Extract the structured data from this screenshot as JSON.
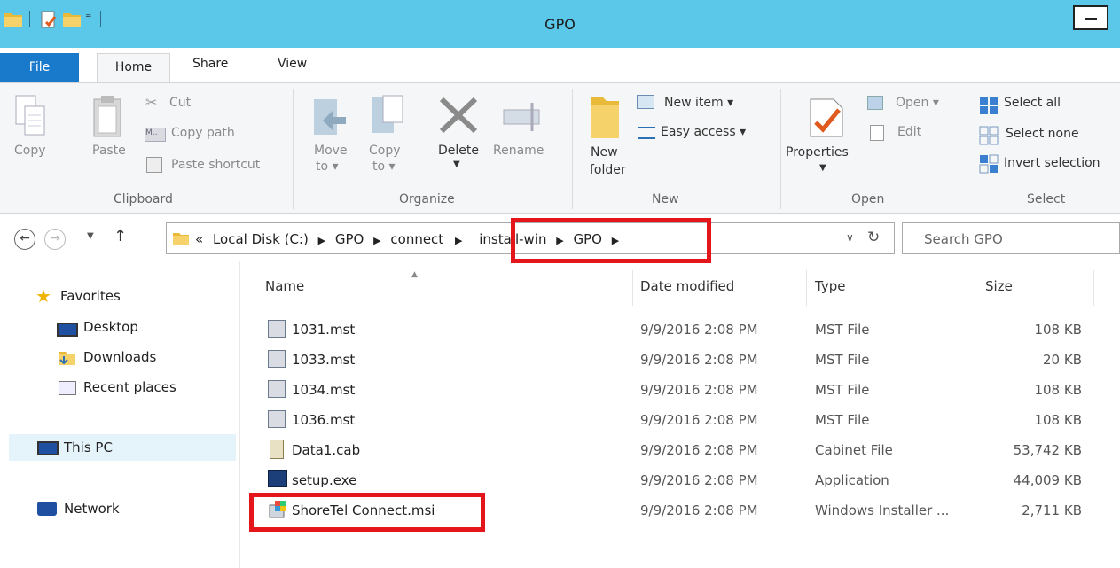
{
  "window": {
    "title": "GPO"
  },
  "tabs": {
    "file": "File",
    "home": "Home",
    "share": "Share",
    "view": "View"
  },
  "ribbon": {
    "copy": "Copy",
    "paste": "Paste",
    "cut": "Cut",
    "copy_path": "Copy path",
    "paste_shortcut": "Paste shortcut",
    "clipboard": "Clipboard",
    "move_to_1": "Move",
    "move_to_2": "to ▾",
    "copy_to_1": "Copy",
    "copy_to_2": "to ▾",
    "delete": "Delete",
    "rename": "Rename",
    "organize": "Organize",
    "new_folder_1": "New",
    "new_folder_2": "folder",
    "new_item": "New item ▾",
    "easy_access": "Easy access ▾",
    "new": "New",
    "properties": "Properties",
    "open_btn": "Open ▾",
    "edit": "Edit",
    "open": "Open",
    "select_all": "Select all",
    "select_none": "Select none",
    "invert_selection": "Invert selection",
    "select": "Select"
  },
  "address": {
    "prefix": "«",
    "crumbs": [
      "Local Disk (C:)",
      "GPO",
      "connect",
      "install-win",
      "GPO"
    ],
    "search_placeholder": "Search GPO"
  },
  "nav": {
    "favorites": "Favorites",
    "desktop": "Desktop",
    "downloads": "Downloads",
    "recent": "Recent places",
    "this_pc": "This PC",
    "network": "Network"
  },
  "columns": {
    "name": "Name",
    "date": "Date modified",
    "type": "Type",
    "size": "Size"
  },
  "files": [
    {
      "name": "1031.mst",
      "date": "9/9/2016 2:08 PM",
      "type": "MST File",
      "size": "108 KB"
    },
    {
      "name": "1033.mst",
      "date": "9/9/2016 2:08 PM",
      "type": "MST File",
      "size": "20 KB"
    },
    {
      "name": "1034.mst",
      "date": "9/9/2016 2:08 PM",
      "type": "MST File",
      "size": "108 KB"
    },
    {
      "name": "1036.mst",
      "date": "9/9/2016 2:08 PM",
      "type": "MST File",
      "size": "108 KB"
    },
    {
      "name": "Data1.cab",
      "date": "9/9/2016 2:08 PM",
      "type": "Cabinet File",
      "size": "53,742 KB"
    },
    {
      "name": "setup.exe",
      "date": "9/9/2016 2:08 PM",
      "type": "Application",
      "size": "44,009 KB"
    },
    {
      "name": "ShoreTel Connect.msi",
      "date": "9/9/2016 2:08 PM",
      "type": "Windows Installer ...",
      "size": "2,711 KB"
    }
  ],
  "colors": {
    "titlebar": "#5bc8ea",
    "file_tab": "#1979ca",
    "highlight": "#e4151b"
  }
}
